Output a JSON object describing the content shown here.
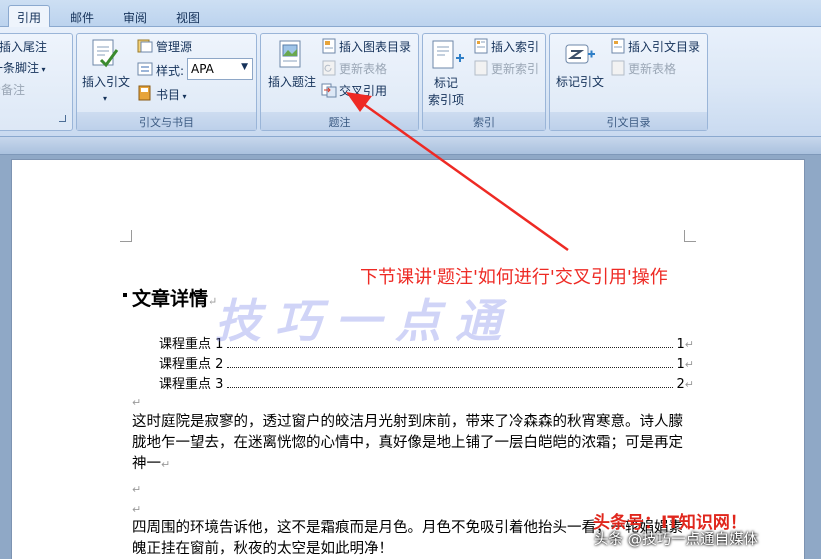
{
  "tabs": [
    "引用",
    "邮件",
    "审阅",
    "视图"
  ],
  "footnotes": {
    "insert_endnote": "插入尾注",
    "next_footnote": "下一条脚注",
    "show_notes": "显示备注"
  },
  "citations": {
    "insert_citation": "插入引文",
    "manage_sources": "管理源",
    "style_label": "样式:",
    "style_value": "APA",
    "bibliography": "书目",
    "group_label": "引文与书目"
  },
  "captions": {
    "insert_caption": "插入题注",
    "insert_table_of_figures": "插入图表目录",
    "update_table": "更新表格",
    "cross_reference": "交叉引用",
    "group_label": "题注"
  },
  "index": {
    "mark_entry_line1": "标记",
    "mark_entry_line2": "索引项",
    "insert_index": "插入索引",
    "update_index": "更新索引",
    "group_label": "索引"
  },
  "authorities": {
    "mark_citation": "标记引文",
    "insert_table_of_authorities": "插入引文目录",
    "update_table": "更新表格",
    "group_label": "引文目录"
  },
  "document": {
    "title": "文章详情",
    "toc": [
      {
        "label": "课程重点  1",
        "page": "1"
      },
      {
        "label": "课程重点  2",
        "page": "1"
      },
      {
        "label": "课程重点  3",
        "page": "2"
      }
    ],
    "paragraph1": "这时庭院是寂寥的，透过窗户的皎洁月光射到床前，带来了冷森森的秋宵寒意。诗人朦胧地乍一望去，在迷离恍惚的心情中，真好像是地上铺了一层白皑皑的浓霜；可是再定神一",
    "paragraph2": "四周围的环境告诉他，这不是霜痕而是月色。月色不免吸引着他抬头一看，一轮娟娟素魄正挂在窗前，秋夜的太空是如此明净！"
  },
  "annotation": "下节课讲'题注'如何进行'交叉引用'操作",
  "watermark_text": "技巧一点通",
  "brand_text": "头条号：IT知识网！",
  "credit_text": "头条 @技巧一点通自媒体",
  "colors": {
    "annotation": "#ee2a24",
    "ribbon": "#dbe7f6",
    "workspace": "#8fa8c6"
  }
}
